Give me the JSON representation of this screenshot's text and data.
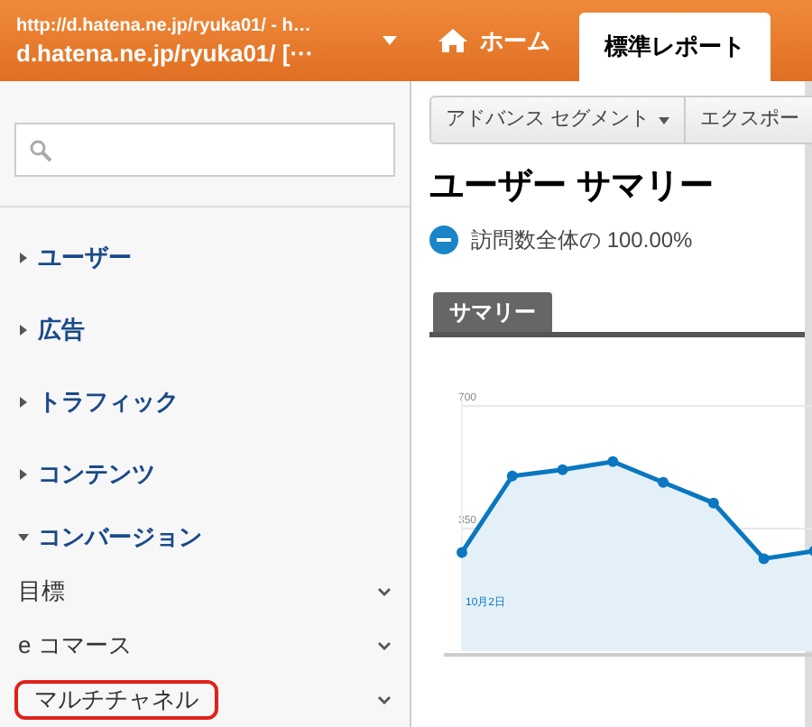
{
  "account": {
    "url": "http://d.hatena.ne.jp/ryuka01/ - h…",
    "name": "d.hatena.ne.jp/ryuka01/ [···"
  },
  "tabs": [
    {
      "label": "ホーム",
      "kind": "home",
      "selected": false
    },
    {
      "label": "標準レポート",
      "kind": "plain",
      "selected": true
    }
  ],
  "nav": [
    {
      "label": "ユーザー",
      "expanded": false
    },
    {
      "label": "広告",
      "expanded": false
    },
    {
      "label": "トラフィック",
      "expanded": false
    },
    {
      "label": "コンテンツ",
      "expanded": false
    },
    {
      "label": "コンバージョン",
      "expanded": true,
      "children": [
        {
          "label": "目標",
          "highlighted": false
        },
        {
          "label": "e コマース",
          "highlighted": false
        },
        {
          "label": "マルチチャネル",
          "highlighted": true
        }
      ]
    }
  ],
  "toolbar": [
    {
      "label": "アドバンス セグメント",
      "kind": "dropdown"
    },
    {
      "label": "エクスポー",
      "kind": "button"
    }
  ],
  "title": "ユーザー サマリー",
  "segment": {
    "label": "訪問数全体の 100.00%",
    "color": "#1a86c8"
  },
  "section_tab": "サマリー",
  "chart_data": {
    "type": "area",
    "annotations": [
      {
        "text": "10月2日"
      }
    ],
    "yticks": [
      {
        "value": 350,
        "label": "350"
      },
      {
        "value": 700,
        "label": "700"
      }
    ],
    "ylim": [
      0,
      700
    ],
    "series": [
      {
        "color": "#0a77c0",
        "values": [
          282,
          500,
          518,
          541,
          482,
          423,
          264,
          286
        ]
      }
    ]
  }
}
